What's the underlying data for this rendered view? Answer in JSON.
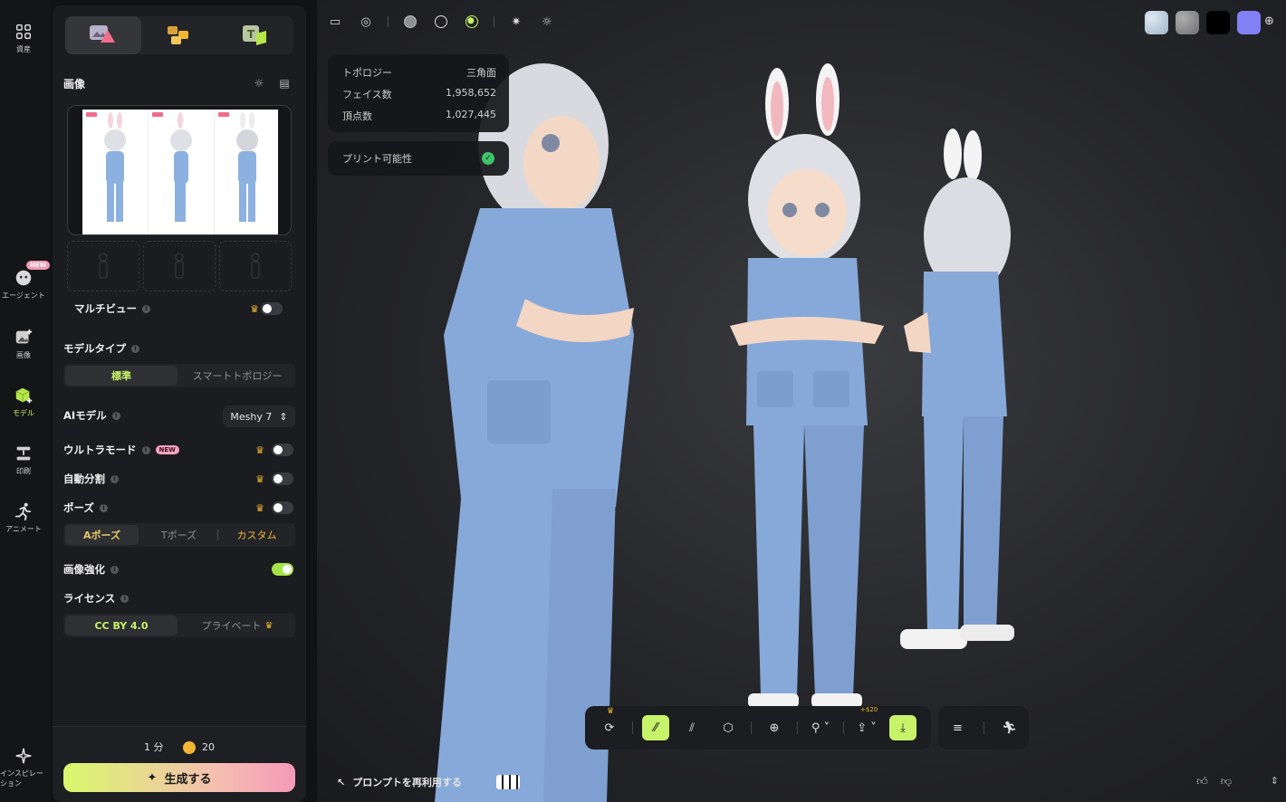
{
  "rail": {
    "assets": "資産",
    "agent": "エージェント",
    "agent_badge": "NEW",
    "image": "画像",
    "model": "モデル",
    "print": "印刷",
    "animate": "アニメート",
    "inspiration": "インスピレーション"
  },
  "panel": {
    "image_title": "画像",
    "multiview_label": "マルチビュー",
    "model_type_label": "モデルタイプ",
    "model_type_options": [
      "標準",
      "スマートトポロジー"
    ],
    "ai_model_label": "AIモデル",
    "ai_model_value": "Meshy 7",
    "ultra_mode_label": "ウルトラモード",
    "ultra_badge": "NEW",
    "auto_split_label": "自動分割",
    "pose_label": "ポーズ",
    "pose_options": [
      "Aポーズ",
      "Tポーズ",
      "カスタム"
    ],
    "enhance_label": "画像強化",
    "license_label": "ライセンス",
    "license_options": [
      "CC BY 4.0",
      "プライベート"
    ],
    "time": "1 分",
    "credits": "20",
    "generate_label": "生成する"
  },
  "viewport": {
    "stats": {
      "topology_label": "トポロジー",
      "topology_value": "三角面",
      "faces_label": "フェイス数",
      "faces_value": "1,958,652",
      "vertices_label": "頂点数",
      "vertices_value": "1,027,445"
    },
    "printability_label": "プリント可能性",
    "swatch_colors": [
      "#b9c7d8",
      "#8f9094",
      "#000000",
      "#8181f5"
    ],
    "export_price": "+$20",
    "reuse_prompt_label": "プロンプトを再利用する"
  },
  "colors": {
    "accent": "#c6f36a",
    "scrubs": "#86a9d9"
  }
}
